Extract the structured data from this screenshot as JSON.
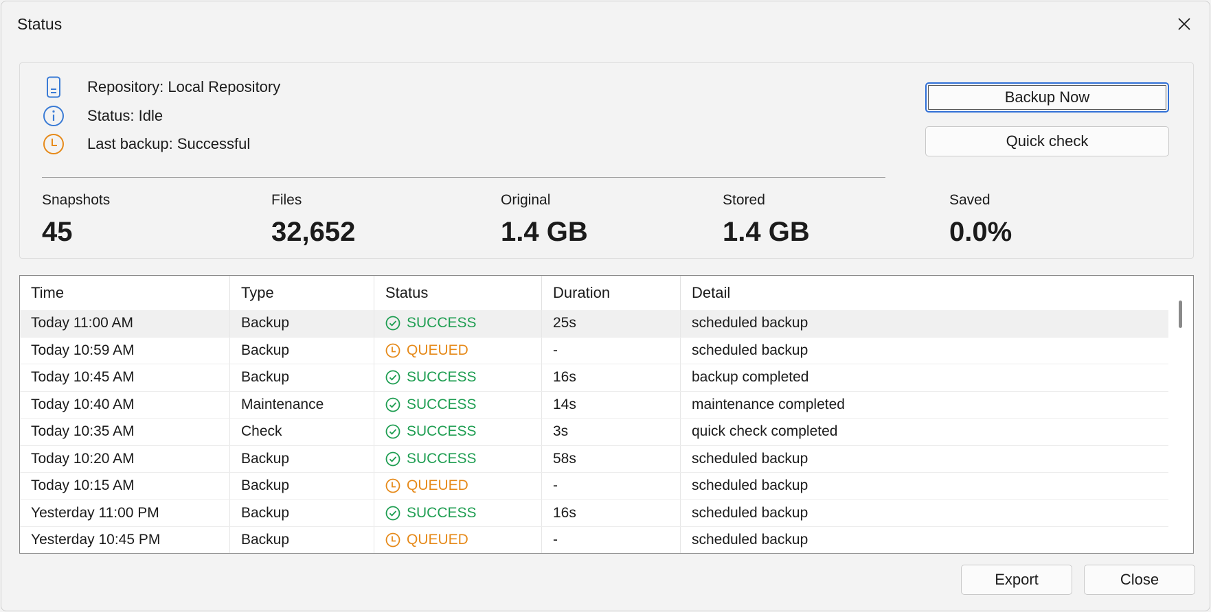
{
  "window": {
    "title": "Status"
  },
  "summary": {
    "repository": "Repository: Local Repository",
    "status": "Status: Idle",
    "last_backup": "Last backup: Successful",
    "stats": [
      {
        "label": "Snapshots",
        "value": "45"
      },
      {
        "label": "Files",
        "value": "32,652"
      },
      {
        "label": "Original",
        "value": "1.4 GB"
      },
      {
        "label": "Stored",
        "value": "1.4 GB"
      },
      {
        "label": "Saved",
        "value": "0.0%"
      }
    ],
    "buttons": {
      "backup_now": "Backup Now",
      "quick_check": "Quick check"
    }
  },
  "table": {
    "columns": [
      "Time",
      "Type",
      "Status",
      "Duration",
      "Detail"
    ],
    "rows": [
      {
        "time": "Today 11:00 AM",
        "type": "Backup",
        "status": "SUCCESS",
        "duration": "25s",
        "detail": "scheduled backup"
      },
      {
        "time": "Today 10:59 AM",
        "type": "Backup",
        "status": "QUEUED",
        "duration": "-",
        "detail": "scheduled backup"
      },
      {
        "time": "Today 10:45 AM",
        "type": "Backup",
        "status": "SUCCESS",
        "duration": "16s",
        "detail": "backup completed"
      },
      {
        "time": "Today 10:40 AM",
        "type": "Maintenance",
        "status": "SUCCESS",
        "duration": "14s",
        "detail": "maintenance completed"
      },
      {
        "time": "Today 10:35 AM",
        "type": "Check",
        "status": "SUCCESS",
        "duration": "3s",
        "detail": "quick check completed"
      },
      {
        "time": "Today 10:20 AM",
        "type": "Backup",
        "status": "SUCCESS",
        "duration": "58s",
        "detail": "scheduled backup"
      },
      {
        "time": "Today 10:15 AM",
        "type": "Backup",
        "status": "QUEUED",
        "duration": "-",
        "detail": "scheduled backup"
      },
      {
        "time": "Yesterday 11:00 PM",
        "type": "Backup",
        "status": "SUCCESS",
        "duration": "16s",
        "detail": "scheduled backup"
      },
      {
        "time": "Yesterday 10:45 PM",
        "type": "Backup",
        "status": "QUEUED",
        "duration": "-",
        "detail": "scheduled backup"
      }
    ]
  },
  "footer": {
    "export": "Export",
    "close": "Close"
  },
  "colors": {
    "success": "#1f9e52",
    "queued": "#e68a1a",
    "info": "#3a7bd5",
    "accent": "#2f6fd6"
  },
  "icons": {
    "repository": "phone-icon",
    "status": "info-icon",
    "last_backup": "clock-icon",
    "success": "check-circle-icon",
    "queued": "clock-icon",
    "close": "close-icon"
  }
}
